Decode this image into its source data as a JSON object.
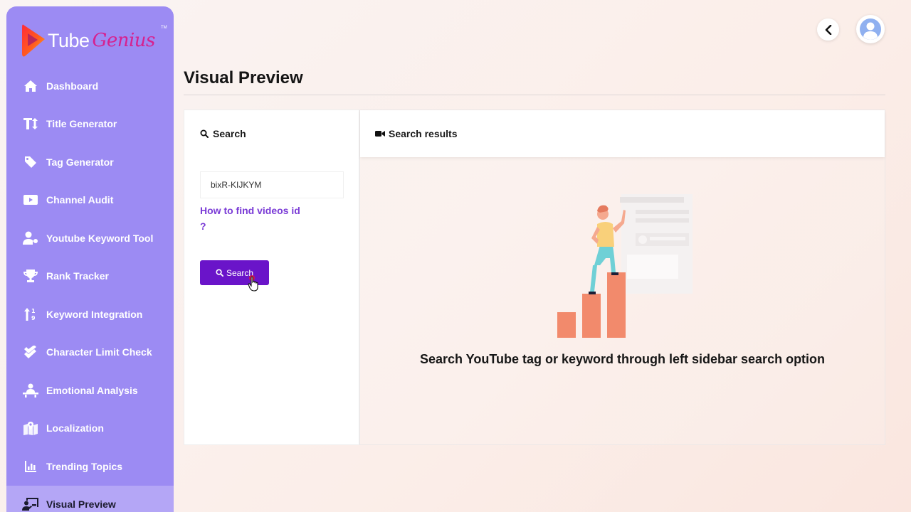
{
  "brand": {
    "name_part1": "Tube",
    "name_part2": "Genius",
    "tm": "TM"
  },
  "sidebar": {
    "items": [
      {
        "label": "Dashboard",
        "icon": "home-icon"
      },
      {
        "label": "Title Generator",
        "icon": "text-height-icon"
      },
      {
        "label": "Tag Generator",
        "icon": "tag-icon"
      },
      {
        "label": "Channel Audit",
        "icon": "youtube-icon"
      },
      {
        "label": "Youtube Keyword Tool",
        "icon": "user-key-icon"
      },
      {
        "label": "Rank Tracker",
        "icon": "trophy-icon"
      },
      {
        "label": "Keyword Integration",
        "icon": "sort-alpha-icon"
      },
      {
        "label": "Character Limit Check",
        "icon": "double-check-icon"
      },
      {
        "label": "Emotional Analysis",
        "icon": "person-desk-icon"
      },
      {
        "label": "Localization",
        "icon": "map-marker-icon"
      },
      {
        "label": "Trending Topics",
        "icon": "bar-chart-icon"
      },
      {
        "label": "Visual Preview",
        "icon": "chalkboard-user-icon",
        "active": true
      }
    ]
  },
  "header": {
    "page_title": "Visual Preview"
  },
  "search_panel": {
    "heading": "Search",
    "input_value": "bixR-KIJKYM",
    "help_link": "How to find videos id ?",
    "button_label": "Search"
  },
  "results_panel": {
    "heading": "Search results",
    "empty_message": "Search YouTube tag or keyword through left sidebar search option"
  },
  "colors": {
    "sidebar_bg": "#9c8bf3",
    "accent_button": "#6a14c9",
    "link": "#7a3bd6",
    "brand_pink": "#d6218f"
  }
}
